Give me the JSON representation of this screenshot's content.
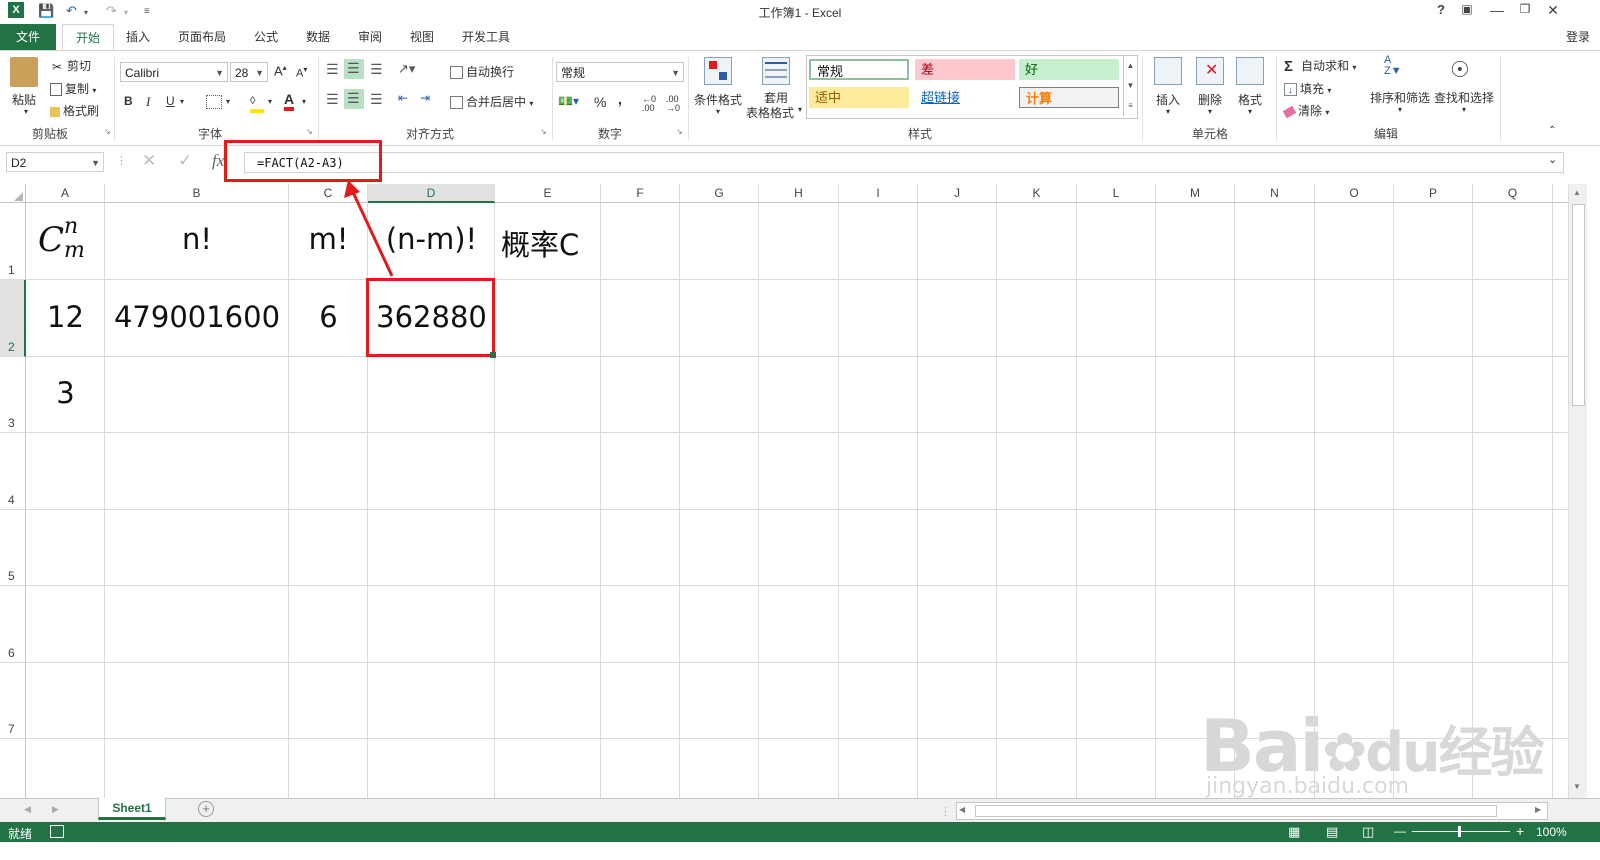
{
  "window": {
    "title": "工作簿1 - Excel",
    "signin": "登录",
    "help": "?"
  },
  "tabs": [
    {
      "label": "文件"
    },
    {
      "label": "开始"
    },
    {
      "label": "插入"
    },
    {
      "label": "页面布局"
    },
    {
      "label": "公式"
    },
    {
      "label": "数据"
    },
    {
      "label": "审阅"
    },
    {
      "label": "视图"
    },
    {
      "label": "开发工具"
    }
  ],
  "ribbon": {
    "clipboard": {
      "paste": "粘贴",
      "cut": "剪切",
      "copy": "复制",
      "format_painter": "格式刷",
      "label": "剪贴板"
    },
    "font": {
      "name": "Calibri",
      "size": "28",
      "bold": "B",
      "italic": "I",
      "underline": "U",
      "label": "字体"
    },
    "alignment": {
      "wrap": "自动换行",
      "merge": "合并后居中",
      "label": "对齐方式"
    },
    "number": {
      "format": "常规",
      "percent": "%",
      "comma": ",",
      "label": "数字"
    },
    "styles": {
      "conditional": "条件格式",
      "table_format_l1": "套用",
      "table_format_l2": "表格格式",
      "cells": [
        "常规",
        "差",
        "好",
        "适中",
        "超链接",
        "计算"
      ],
      "label": "样式"
    },
    "cells_group": {
      "insert": "插入",
      "delete": "删除",
      "format": "格式",
      "label": "单元格"
    },
    "editing": {
      "autosum": "自动求和",
      "fill": "填充",
      "clear": "清除",
      "sort": "排序和筛选",
      "find": "查找和选择",
      "label": "编辑"
    }
  },
  "formula_bar": {
    "name_box": "D2",
    "fx": "fx",
    "formula": "=FACT(A2-A3)"
  },
  "columns": [
    "A",
    "B",
    "C",
    "D",
    "E",
    "F",
    "G",
    "H",
    "I",
    "J",
    "K",
    "L",
    "M",
    "N",
    "O",
    "P",
    "Q"
  ],
  "rows": [
    "1",
    "2",
    "3",
    "4",
    "5",
    "6",
    "7"
  ],
  "cells": {
    "B1": "n!",
    "C1": "m!",
    "D1": "(n-m)!",
    "E1": "概率C",
    "A2": "12",
    "B2": "479001600",
    "C2": "6",
    "D2": "362880",
    "A3": "3"
  },
  "a1_formula": {
    "base": "C",
    "sup": "n",
    "sub": "m"
  },
  "sheets": [
    {
      "name": "Sheet1"
    }
  ],
  "status": {
    "ready": "就绪",
    "zoom": "100%"
  },
  "watermark": {
    "main": "Bai",
    "du": "du",
    "cn": "经验",
    "url": "jingyan.baidu.com"
  },
  "colors": {
    "accent": "#217346",
    "highlight": "#e31b1b"
  }
}
